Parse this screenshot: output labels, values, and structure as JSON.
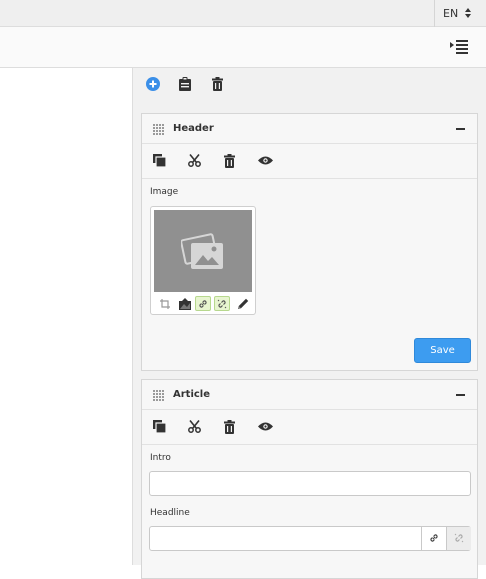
{
  "topbar": {
    "language": "EN"
  },
  "icons": {
    "outdent": "indent-lines-icon",
    "add": "plus-circle-icon",
    "paste": "clipboard-icon",
    "delete": "trash-icon",
    "drag": "drag-grip-icon",
    "collapse": "minus-icon",
    "copy": "copy-icon",
    "cut": "scissors-icon",
    "preview": "eye-icon",
    "image_placeholder": "image-placeholder-icon",
    "crop": "crop-icon",
    "gallery": "image-upload-icon",
    "link": "link-icon",
    "unlink": "unlink-icon",
    "edit": "pencil-icon"
  },
  "colors": {
    "accent": "#3d9cf0",
    "add_icon": "#3b8fe8",
    "link_highlight": "#e8f5d0",
    "panel_bg": "#f7f7f7",
    "pane_bg": "#f1f1f1"
  },
  "panels": {
    "header": {
      "title": "Header",
      "image_label": "Image",
      "save_label": "Save"
    },
    "article": {
      "title": "Article",
      "intro_label": "Intro",
      "intro_value": "",
      "headline_label": "Headline",
      "headline_value": ""
    }
  }
}
